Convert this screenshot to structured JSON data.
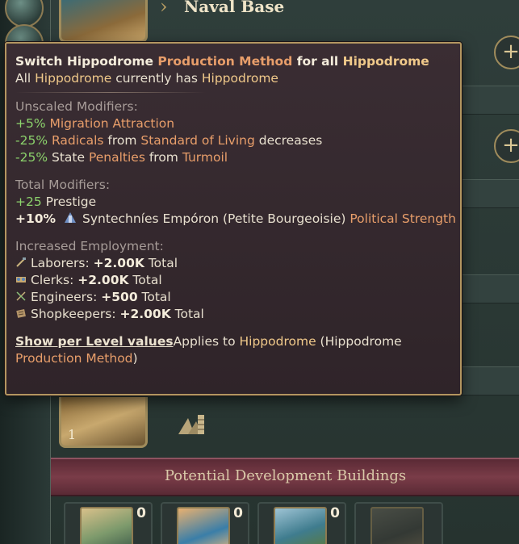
{
  "header": {
    "title": "Naval Base"
  },
  "tooltip": {
    "title": {
      "p1": "Switch Hippodrome ",
      "p2": "Production Method",
      "p3": " for all ",
      "p4": "Hippodrome"
    },
    "subtitle": {
      "p1": "All ",
      "p2": "Hippodrome",
      "p3": " currently has ",
      "p4": "Hippodrome"
    },
    "unscaled": {
      "heading": "Unscaled Modifiers:",
      "items": [
        {
          "value": "+5%",
          "label": " Migration Attraction"
        },
        {
          "value": "-25%",
          "l1": " Radicals",
          "l2": " from ",
          "l3": "Standard of Living",
          "l4": " decreases"
        },
        {
          "value": "-25%",
          "l1": " State ",
          "l2": "Penalties",
          "l3": " from ",
          "l4": "Turmoil"
        }
      ]
    },
    "total": {
      "heading": "Total Modifiers:",
      "prestige": {
        "value": "+25",
        "label": " Prestige"
      },
      "political": {
        "value": "+10%",
        "group": "Syntechníes Empóron (Petite Bourgeoisie) ",
        "label": "Political Strength"
      }
    },
    "employment": {
      "heading": "Increased Employment:",
      "items": [
        {
          "icon": "laborers-icon",
          "name": "Laborers",
          "value": "+2.00K",
          "suffix": " Total"
        },
        {
          "icon": "clerks-icon",
          "name": "Clerks",
          "value": "+2.00K",
          "suffix": " Total"
        },
        {
          "icon": "engineers-icon",
          "name": "Engineers",
          "value": "+500",
          "suffix": " Total"
        },
        {
          "icon": "shopkeepers-icon",
          "name": "Shopkeepers",
          "value": "+2.00K",
          "suffix": " Total"
        }
      ]
    },
    "footer": {
      "link": "Show per Level values",
      "applies": "Applies to ",
      "building": "Hippodrome",
      "paren_open": " (Hippodrome ",
      "pm": "Production Method",
      "paren_close": ")"
    }
  },
  "building": {
    "level": "1"
  },
  "development": {
    "title": "Potential Development Buildings",
    "cards": [
      {
        "count": "0"
      },
      {
        "count": "0"
      },
      {
        "count": "0"
      },
      {
        "count": ""
      }
    ]
  },
  "colors": {
    "green": "#8cd36c",
    "orange": "#e89e6a",
    "gold": "#f0c98a",
    "border": "#b39660"
  }
}
